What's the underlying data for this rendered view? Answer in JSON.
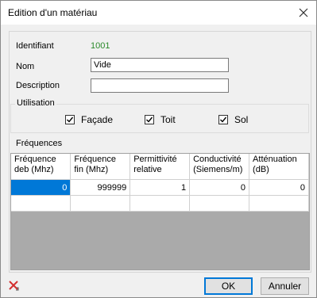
{
  "window": {
    "title": "Edition d'un matériau"
  },
  "form": {
    "identifiant_label": "Identifiant",
    "identifiant_value": "1001",
    "nom_label": "Nom",
    "nom_value": "Vide",
    "description_label": "Description",
    "description_value": ""
  },
  "utilisation": {
    "legend": "Utilisation",
    "options": [
      {
        "label": "Façade",
        "checked": true
      },
      {
        "label": "Toit",
        "checked": true
      },
      {
        "label": "Sol",
        "checked": true
      }
    ]
  },
  "frequences": {
    "label": "Fréquences",
    "columns": [
      "Fréquence deb (Mhz)",
      "Fréquence fin (Mhz)",
      "Permittivité relative",
      "Conductivité (Siemens/m)",
      "Atténuation (dB)"
    ],
    "rows": [
      [
        "0",
        "999999",
        "1",
        "0",
        "0"
      ],
      [
        "",
        "",
        "",
        "",
        ""
      ]
    ]
  },
  "buttons": {
    "ok": "OK",
    "cancel": "Annuler"
  },
  "icons": {
    "close": "close-icon",
    "delete": "delete-x-icon",
    "check": "check-icon"
  },
  "colors": {
    "identifier": "#2b8a2b",
    "selection": "#0078d7",
    "delete": "#d32f2f"
  }
}
